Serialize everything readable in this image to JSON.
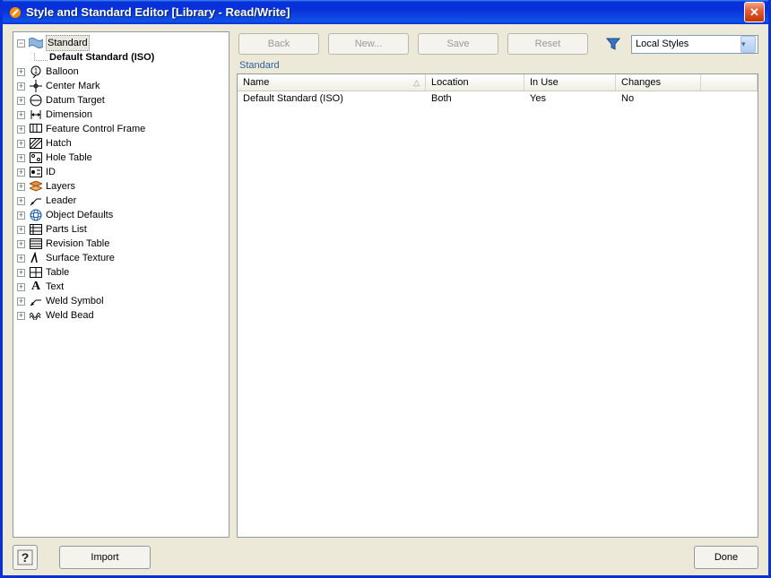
{
  "window": {
    "title": "Style and Standard Editor [Library - Read/Write]"
  },
  "toolbar": {
    "back": "Back",
    "new": "New...",
    "save": "Save",
    "reset": "Reset"
  },
  "filter": {
    "selected": "Local Styles"
  },
  "panel_label": "Standard",
  "columns": {
    "name": "Name",
    "location": "Location",
    "in_use": "In Use",
    "changes": "Changes"
  },
  "rows": [
    {
      "name": "Default Standard (ISO)",
      "location": "Both",
      "in_use": "Yes",
      "changes": "No"
    }
  ],
  "tree": {
    "root_label": "Standard",
    "selected_child": "Default Standard (ISO)",
    "items": [
      "Balloon",
      "Center Mark",
      "Datum Target",
      "Dimension",
      "Feature Control Frame",
      "Hatch",
      "Hole Table",
      "ID",
      "Layers",
      "Leader",
      "Object Defaults",
      "Parts List",
      "Revision Table",
      "Surface Texture",
      "Table",
      "Text",
      "Weld Symbol",
      "Weld Bead"
    ]
  },
  "buttons": {
    "help": "?",
    "import": "Import",
    "done": "Done"
  },
  "icons": {
    "close": "✕",
    "dropdown": "▾",
    "sort": "△",
    "plus": "+",
    "minus": "−"
  }
}
